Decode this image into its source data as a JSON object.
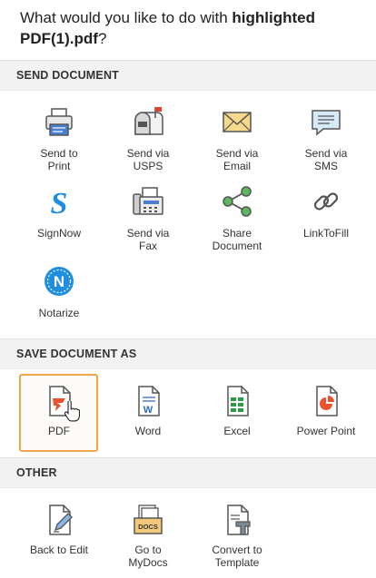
{
  "header": {
    "prefix": "What would you like to do with ",
    "filename": "highlighted PDF(1).pdf",
    "suffix": "?"
  },
  "sections": {
    "send": "SEND DOCUMENT",
    "save": "SAVE DOCUMENT AS",
    "other": "OTHER"
  },
  "send_items": {
    "print": {
      "line1": "Send to",
      "line2": "Print",
      "icon": "printer-icon"
    },
    "usps": {
      "line1": "Send via",
      "line2": "USPS",
      "icon": "mailbox-icon"
    },
    "email": {
      "line1": "Send via",
      "line2": "Email",
      "icon": "envelope-icon"
    },
    "sms": {
      "line1": "Send via",
      "line2": "SMS",
      "icon": "chat-bubble-icon"
    },
    "signnow": {
      "line1": "SignNow",
      "icon": "signnow-logo-icon",
      "glyph": "S"
    },
    "fax": {
      "line1": "Send via",
      "line2": "Fax",
      "icon": "fax-machine-icon"
    },
    "share": {
      "line1": "Share",
      "line2": "Document",
      "icon": "share-icon"
    },
    "linktofill": {
      "line1": "LinkToFill",
      "icon": "link-icon"
    },
    "notarize": {
      "line1": "Notarize",
      "icon": "notarize-logo-icon",
      "glyph": "N"
    }
  },
  "save_items": {
    "pdf": {
      "line1": "PDF",
      "icon": "pdf-file-icon",
      "selected": true
    },
    "word": {
      "line1": "Word",
      "icon": "word-file-icon",
      "glyph": "W"
    },
    "excel": {
      "line1": "Excel",
      "icon": "excel-file-icon"
    },
    "ppt": {
      "line1": "Power Point",
      "icon": "powerpoint-file-icon"
    }
  },
  "other_items": {
    "edit": {
      "line1": "Back to Edit",
      "icon": "edit-document-icon"
    },
    "mydocs": {
      "line1": "Go to",
      "line2": "MyDocs",
      "icon": "docs-folder-icon",
      "glyph": "DOCS"
    },
    "template": {
      "line1": "Convert to",
      "line2": "Template",
      "icon": "template-icon"
    }
  },
  "colors": {
    "accent_orange": "#f0a54a",
    "pdf_red": "#e8532f",
    "word_blue": "#2f6bc2",
    "excel_green": "#2e9a48",
    "signnow_blue": "#1f8ee0",
    "section_bg": "#f2f2f2"
  }
}
